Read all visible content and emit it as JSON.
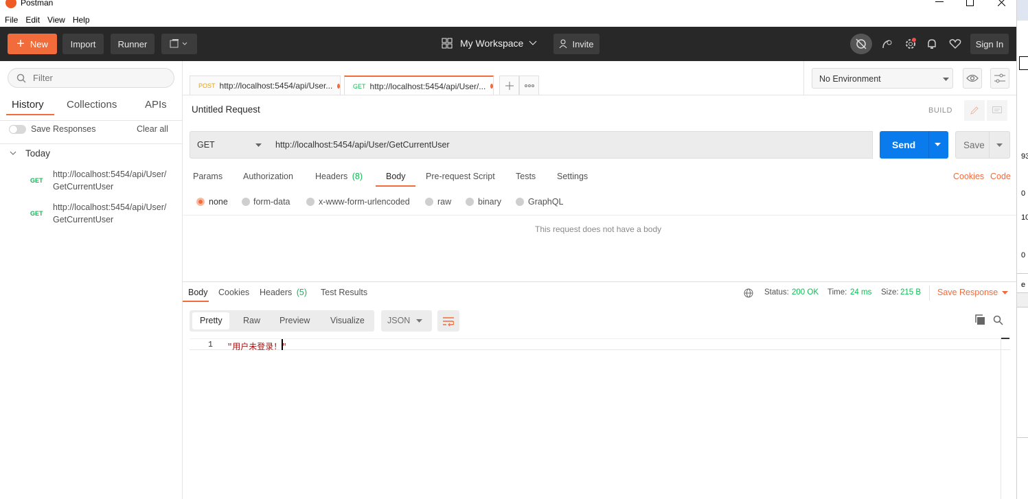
{
  "window": {
    "title": "Postman"
  },
  "menu": [
    "File",
    "Edit",
    "View",
    "Help"
  ],
  "header": {
    "new_label": "New",
    "import_label": "Import",
    "runner_label": "Runner",
    "workspace_label": "My Workspace",
    "invite_label": "Invite",
    "signin_label": "Sign In"
  },
  "sidebar": {
    "filter_placeholder": "Filter",
    "tabs": [
      "History",
      "Collections",
      "APIs"
    ],
    "save_responses_label": "Save Responses",
    "clear_all_label": "Clear all",
    "group_label": "Today",
    "items": [
      {
        "method": "GET",
        "url_line1": "http://localhost:5454/api/User/",
        "url_line2": "GetCurrentUser"
      },
      {
        "method": "GET",
        "url_line1": "http://localhost:5454/api/User/",
        "url_line2": "GetCurrentUser"
      }
    ]
  },
  "request_tabs": [
    {
      "method": "POST",
      "label": "http://localhost:5454/api/User..."
    },
    {
      "method": "GET",
      "label": "http://localhost:5454/api/User/..."
    }
  ],
  "environment": {
    "selected": "No Environment"
  },
  "request": {
    "title": "Untitled Request",
    "build_label": "BUILD",
    "method": "GET",
    "url": "http://localhost:5454/api/User/GetCurrentUser",
    "send_label": "Send",
    "save_label": "Save",
    "tabs": [
      "Params",
      "Authorization",
      "Headers",
      "Body",
      "Pre-request Script",
      "Tests",
      "Settings"
    ],
    "headers_count": "(8)",
    "cookies_label": "Cookies",
    "code_label": "Code",
    "body_types": [
      "none",
      "form-data",
      "x-www-form-urlencoded",
      "raw",
      "binary",
      "GraphQL"
    ],
    "no_body_text": "This request does not have a body"
  },
  "response": {
    "tabs": [
      "Body",
      "Cookies",
      "Headers",
      "Test Results"
    ],
    "headers_count": "(5)",
    "status_label": "Status:",
    "status_value": "200 OK",
    "time_label": "Time:",
    "time_value": "24 ms",
    "size_label": "Size:",
    "size_value": "215 B",
    "save_response_label": "Save Response",
    "formats": [
      "Pretty",
      "Raw",
      "Preview",
      "Visualize"
    ],
    "language": "JSON",
    "line_number": "1",
    "body_text": "\"用户未登录！\""
  },
  "edge_fragments": [
    "93",
    "0",
    "10",
    "0",
    "e"
  ],
  "colors": {
    "accent": "#f26b3a",
    "send": "#097bed",
    "success": "#0cbb52",
    "header_bg": "#282828"
  }
}
